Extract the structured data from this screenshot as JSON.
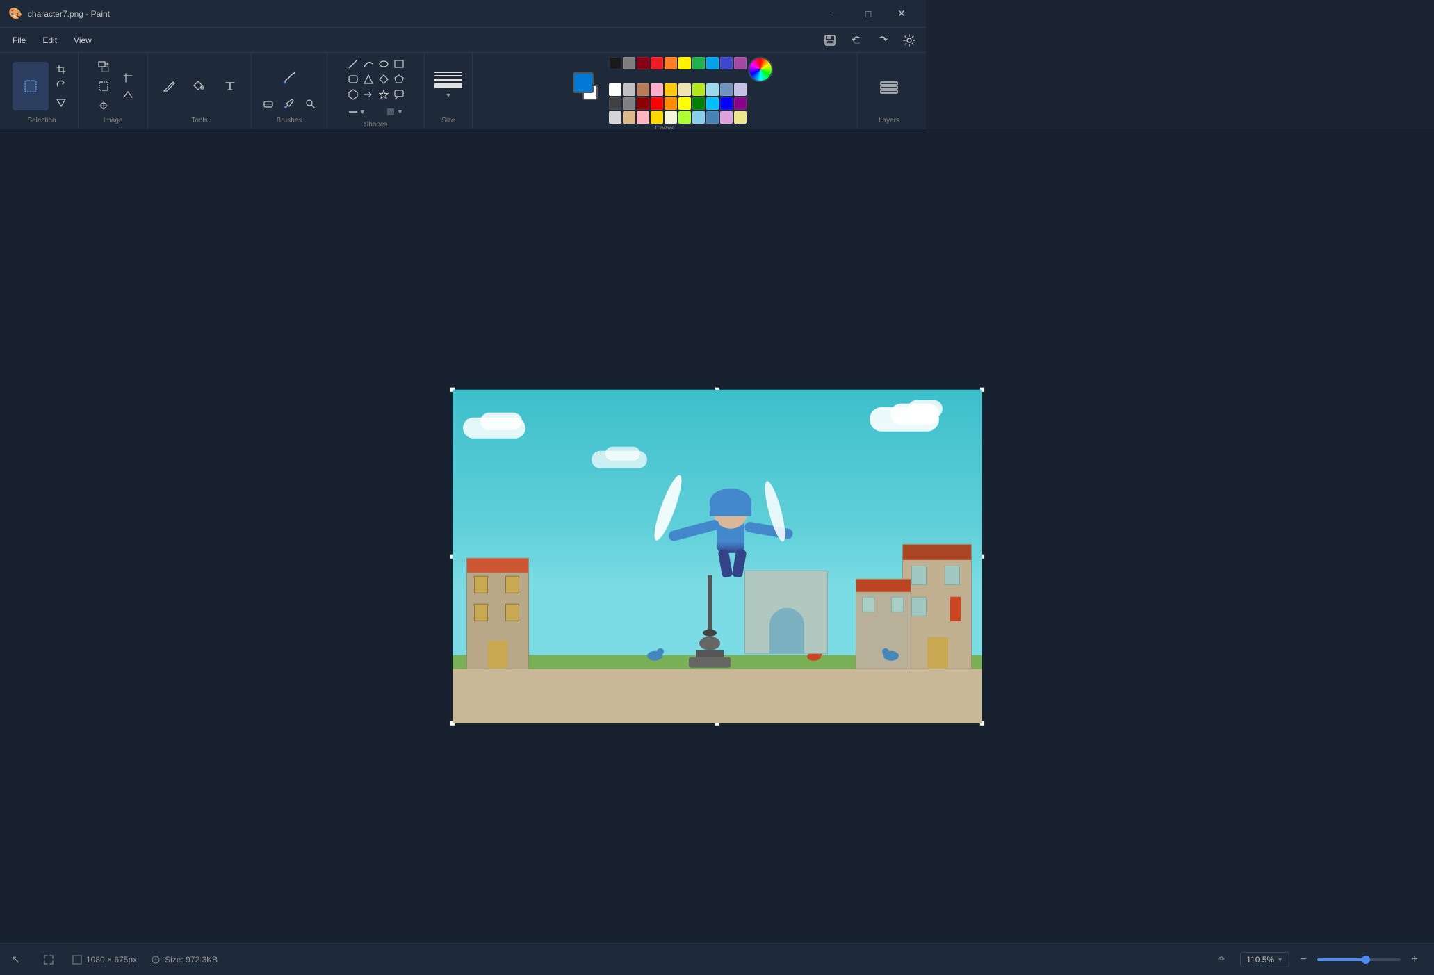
{
  "titleBar": {
    "appName": "character7.png - Paint",
    "iconAlt": "paint-icon",
    "controls": {
      "minimize": "—",
      "maximize": "□",
      "close": "✕"
    }
  },
  "menuBar": {
    "items": [
      "File",
      "Edit",
      "View"
    ],
    "settingsLabel": "⚙"
  },
  "ribbon": {
    "groups": {
      "selection": {
        "label": "Selection",
        "mainIcon": "⬚"
      },
      "image": {
        "label": "Image"
      },
      "tools": {
        "label": "Tools",
        "items": [
          "✏",
          "🪣",
          "A"
        ]
      },
      "brushes": {
        "label": "Brushes",
        "icon": "🖌"
      },
      "shapes": {
        "label": "Shapes"
      },
      "size": {
        "label": "Size"
      },
      "colors": {
        "label": "Colors"
      },
      "layers": {
        "label": "Layers",
        "icon": "⧉"
      }
    }
  },
  "colorPalette": {
    "activeColor": "#0078d4",
    "activeBackground": "#ffffff",
    "swatches": [
      "#000000",
      "#7f7f7f",
      "#c0c0c0",
      "#ffffff",
      "#880015",
      "#ed1c24",
      "#ff7f27",
      "#fff200",
      "#22b14c",
      "#00a2e8",
      "#3f48cc",
      "#a349a4",
      "#b97a57",
      "#ffaec9",
      "#ffc90e",
      "#efe4b0",
      "#b5e61d",
      "#99d9ea",
      "#7092be",
      "#c8bfe7",
      "#1a1a1a",
      "#404040",
      "#808080",
      "#d4d4d4",
      "#8b0000",
      "#ff0000",
      "#ff8c00",
      "#ffff00",
      "#008000",
      "#00bfff",
      "#0000ff",
      "#8b008b",
      "#deb887",
      "#ffb6c1",
      "#ffd700",
      "#f5f5dc",
      "#adff2f",
      "#87ceeb",
      "#4682b4",
      "#dda0dd"
    ]
  },
  "canvas": {
    "imageFile": "character7.png",
    "displayWidth": 762,
    "displayHeight": 480
  },
  "statusBar": {
    "cursorLabel": "cursor",
    "dimensionsLabel": "1080 × 675px",
    "sizeLabel": "Size: 972.3KB",
    "zoomValue": "110.5%",
    "zoomMin": "−",
    "zoomMax": "+"
  }
}
